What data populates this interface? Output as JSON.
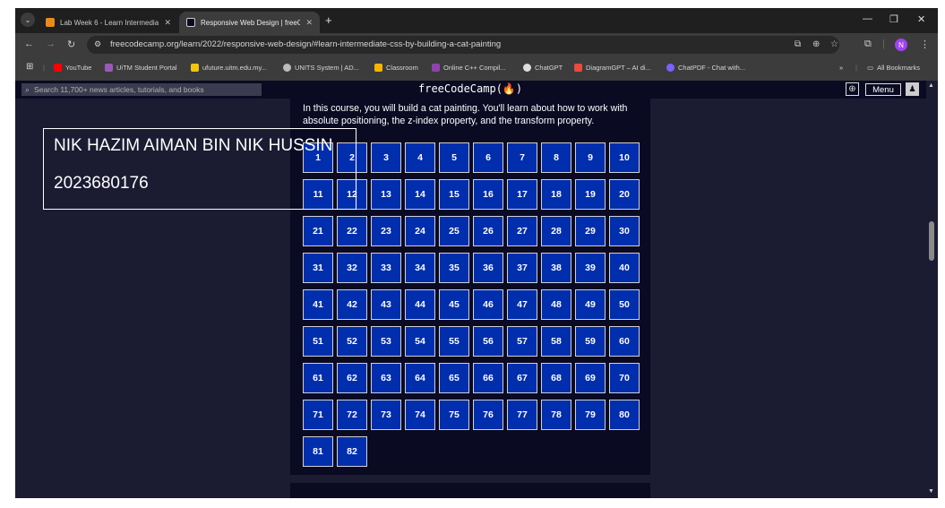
{
  "browser": {
    "tabs": [
      {
        "title": "Lab Week 6 - Learn Intermediat",
        "active": false,
        "favicon_color": "#ea8a1a"
      },
      {
        "title": "Responsive Web Design | freeC",
        "active": true,
        "favicon_color": "#0a0a23"
      }
    ],
    "url": "freecodecamp.org/learn/2022/responsive-web-design/#learn-intermediate-css-by-building-a-cat-painting",
    "bookmarks": [
      {
        "label": "YouTube",
        "color": "#ff0000"
      },
      {
        "label": "UiTM Student Portal",
        "color": "#9b59b6"
      },
      {
        "label": "ufuture.uitm.edu.my...",
        "color": "#f1c40f"
      },
      {
        "label": "UNITS System | AD...",
        "color": "#bbbbbb"
      },
      {
        "label": "Classroom",
        "color": "#f4b400"
      },
      {
        "label": "Online C++ Compil...",
        "color": "#8e44ad"
      },
      {
        "label": "ChatGPT",
        "color": "#dddddd"
      },
      {
        "label": "DiagramGPT – AI di...",
        "color": "#e74c3c"
      },
      {
        "label": "ChatPDF - Chat with...",
        "color": "#7b61ff"
      }
    ],
    "all_bookmarks": "All Bookmarks",
    "profile_initial": "N",
    "profile_color": "#a142f4"
  },
  "fcc": {
    "search_placeholder": "Search 11,700+ news articles, tutorials, and books",
    "logo": "freeCodeCamp(🔥)",
    "menu_label": "Menu"
  },
  "course": {
    "description": "In this course, you will build a cat painting. You'll learn about how to work with absolute positioning, the z-index property, and the transform property.",
    "steps": [
      "1",
      "2",
      "3",
      "4",
      "5",
      "6",
      "7",
      "8",
      "9",
      "10",
      "11",
      "12",
      "13",
      "14",
      "15",
      "16",
      "17",
      "18",
      "19",
      "20",
      "21",
      "22",
      "23",
      "24",
      "25",
      "26",
      "27",
      "28",
      "29",
      "30",
      "31",
      "32",
      "33",
      "34",
      "35",
      "36",
      "37",
      "38",
      "39",
      "40",
      "41",
      "42",
      "43",
      "44",
      "45",
      "46",
      "47",
      "48",
      "49",
      "50",
      "51",
      "52",
      "53",
      "54",
      "55",
      "56",
      "57",
      "58",
      "59",
      "60",
      "61",
      "62",
      "63",
      "64",
      "65",
      "66",
      "67",
      "68",
      "69",
      "70",
      "71",
      "72",
      "73",
      "74",
      "75",
      "76",
      "77",
      "78",
      "79",
      "80",
      "81",
      "82"
    ]
  },
  "overlay": {
    "name": "NIK HAZIM AIMAN BIN NIK HUSSIN",
    "id": "2023680176"
  }
}
